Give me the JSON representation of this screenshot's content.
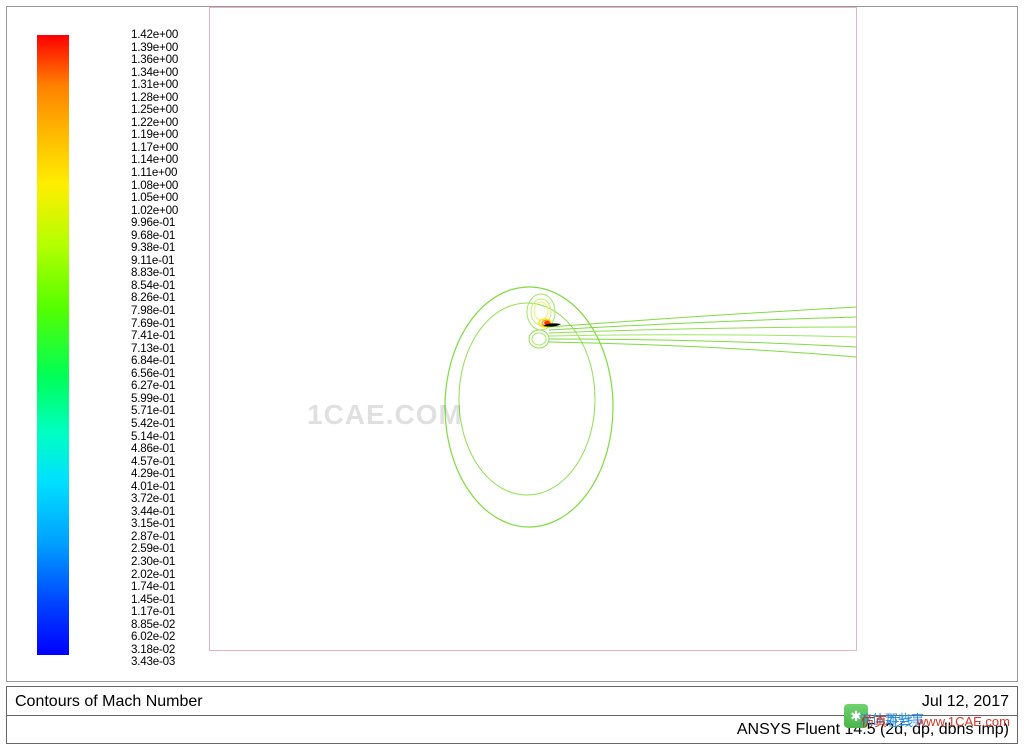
{
  "chart_data": {
    "type": "contour",
    "title": "Contours of Mach Number",
    "variable": "Mach Number",
    "colormap": "jet",
    "value_range": [
      0.00343,
      1.42
    ],
    "legend_levels": [
      "1.42e+00",
      "1.39e+00",
      "1.36e+00",
      "1.34e+00",
      "1.31e+00",
      "1.28e+00",
      "1.25e+00",
      "1.22e+00",
      "1.19e+00",
      "1.17e+00",
      "1.14e+00",
      "1.11e+00",
      "1.08e+00",
      "1.05e+00",
      "1.02e+00",
      "9.96e-01",
      "9.68e-01",
      "9.38e-01",
      "9.11e-01",
      "8.83e-01",
      "8.54e-01",
      "8.26e-01",
      "7.98e-01",
      "7.69e-01",
      "7.41e-01",
      "7.13e-01",
      "6.84e-01",
      "6.56e-01",
      "6.27e-01",
      "5.99e-01",
      "5.71e-01",
      "5.42e-01",
      "5.14e-01",
      "4.86e-01",
      "4.57e-01",
      "4.29e-01",
      "4.01e-01",
      "3.72e-01",
      "3.44e-01",
      "3.15e-01",
      "2.87e-01",
      "2.59e-01",
      "2.30e-01",
      "2.02e-01",
      "1.74e-01",
      "1.45e-01",
      "1.17e-01",
      "8.85e-02",
      "6.02e-02",
      "3.18e-02",
      "3.43e-03"
    ],
    "software": "ANSYS Fluent 14.5 (2d, dp, dbns imp)",
    "date": "Jul 12, 2017",
    "watermark_center": "1CAE.COM",
    "watermark_corner_site": "www.1CAE.com",
    "watermark_corner_cn_prefix": "仿真",
    "watermark_corner_cn_suffix": "在线",
    "watermark_wechat_cn": "流体那些事",
    "description": "Mach-number contour plot around an airfoil leading edge. A small red/orange supersonic pocket (M≈1.4) sits at the leading edge, green contours (M≈0.7) form a large downstream bubble and a thin elongated wake extending to the right boundary."
  }
}
